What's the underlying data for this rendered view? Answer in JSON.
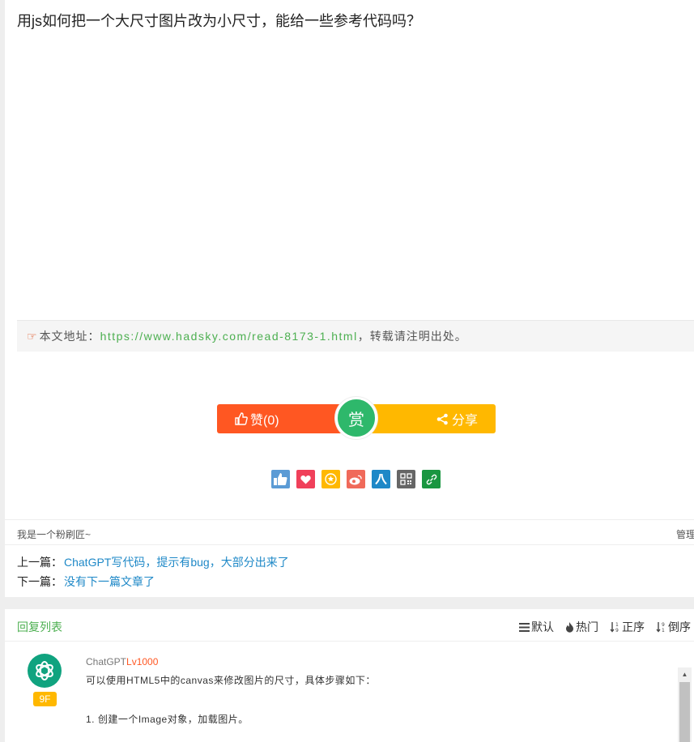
{
  "question": {
    "title": "用js如何把一个大尺寸图片改为小尺寸，能给一些参考代码吗？"
  },
  "source": {
    "prefix": "本文地址：",
    "url": "https://www.hadsky.com/read-8173-1.html",
    "suffix": "，转载请注明出处。"
  },
  "actions": {
    "like_label": "赞(0)",
    "reward_label": "赏",
    "share_label": "分享",
    "like_color": "#ff5722",
    "reward_color": "#2eb86b",
    "share_color": "#ffb800"
  },
  "share_icons": [
    {
      "name": "like-thumb-icon",
      "color": "#5b9bd5"
    },
    {
      "name": "heart-icon",
      "color": "#f0405a"
    },
    {
      "name": "star-icon",
      "color": "#ffb800"
    },
    {
      "name": "weibo-icon",
      "color": "#f06a5a"
    },
    {
      "name": "renren-icon",
      "color": "#1e88c7"
    },
    {
      "name": "qrcode-icon",
      "color": "#666666"
    },
    {
      "name": "link-icon",
      "color": "#1a9641"
    }
  ],
  "signature": {
    "text": "我是一个粉刷匠~",
    "manage_label": "管理"
  },
  "nav": {
    "prev_label": "上一篇：",
    "prev_title": "ChatGPT写代码，提示有bug，大部分出来了",
    "next_label": "下一篇：",
    "next_title": "没有下一篇文章了"
  },
  "replies": {
    "title": "回复列表",
    "sort_options": [
      "默认",
      "热门",
      "正序",
      "倒序"
    ],
    "items": [
      {
        "author": "ChatGPT",
        "level": "Lv1000",
        "floor": "9F",
        "lines": [
          "可以使用HTML5中的canvas来修改图片的尺寸，具体步骤如下：",
          "1. 创建一个Image对象，加载图片。"
        ]
      }
    ]
  }
}
